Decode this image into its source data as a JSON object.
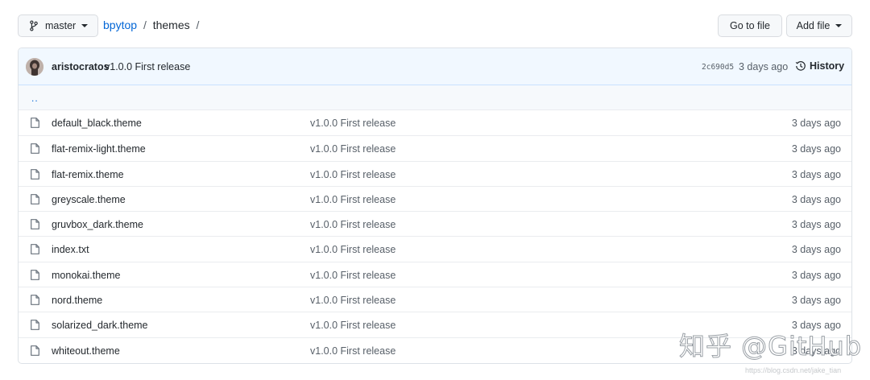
{
  "topbar": {
    "branch": "master",
    "breadcrumb": {
      "repo": "bpytop",
      "sep1": "/",
      "folder": "themes",
      "sep2": "/"
    },
    "go_to_file": "Go to file",
    "add_file": "Add file"
  },
  "commit": {
    "author": "aristocratos",
    "message": "v1.0.0 First release",
    "sha": "2c690d5",
    "time": "3 days ago",
    "history": "History"
  },
  "up_dir": "..",
  "files": [
    {
      "name": "default_black.theme",
      "message": "v1.0.0 First release",
      "time": "3 days ago"
    },
    {
      "name": "flat-remix-light.theme",
      "message": "v1.0.0 First release",
      "time": "3 days ago"
    },
    {
      "name": "flat-remix.theme",
      "message": "v1.0.0 First release",
      "time": "3 days ago"
    },
    {
      "name": "greyscale.theme",
      "message": "v1.0.0 First release",
      "time": "3 days ago"
    },
    {
      "name": "gruvbox_dark.theme",
      "message": "v1.0.0 First release",
      "time": "3 days ago"
    },
    {
      "name": "index.txt",
      "message": "v1.0.0 First release",
      "time": "3 days ago"
    },
    {
      "name": "monokai.theme",
      "message": "v1.0.0 First release",
      "time": "3 days ago"
    },
    {
      "name": "nord.theme",
      "message": "v1.0.0 First release",
      "time": "3 days ago"
    },
    {
      "name": "solarized_dark.theme",
      "message": "v1.0.0 First release",
      "time": "3 days ago"
    },
    {
      "name": "whiteout.theme",
      "message": "v1.0.0 First release",
      "time": "3 days ago"
    }
  ],
  "watermark": "知乎 @GitHub",
  "watermark_url": "https://blog.csdn.net/jake_tian",
  "colors": {
    "link": "#0366d6",
    "commit_bar_bg": "#f1f8ff",
    "border": "#eaecef"
  },
  "icons": {
    "branch": "git-branch-icon",
    "history": "history-clock-icon",
    "file": "file-icon"
  }
}
